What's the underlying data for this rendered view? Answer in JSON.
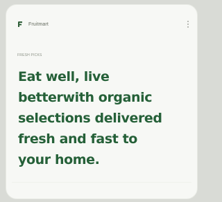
{
  "header": {
    "brand_name": "Fruitmart",
    "brand_icon": "leaf-logo-icon",
    "menu_icon": "vertical-ellipsis-icon"
  },
  "hero": {
    "eyebrow": "FRESH PICKS",
    "headline_lines": [
      "Eat well, live",
      "betterwith organic",
      "selections delivered",
      "fresh and fast to",
      "your home."
    ]
  },
  "colors": {
    "background": "#d9dbd6",
    "card": "#f7f8f5",
    "headline": "#256038"
  }
}
